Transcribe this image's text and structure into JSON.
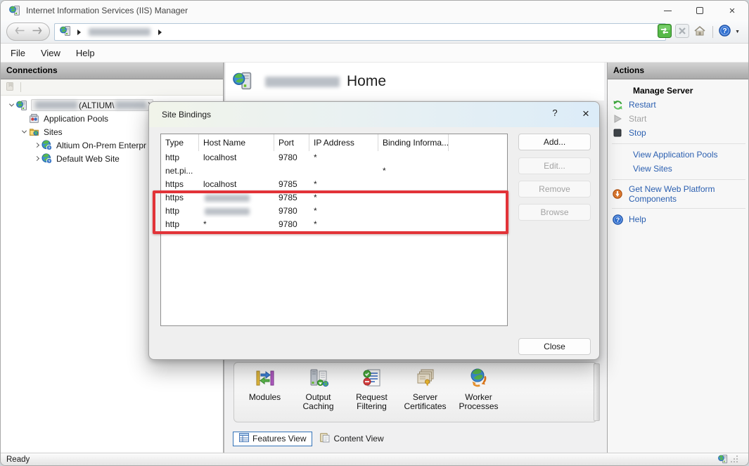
{
  "colors": {
    "link_blue": "#2b5fb0",
    "annotation_red": "#e23338",
    "disabled_gray": "#a3a3a3",
    "go_green": "#56b948",
    "header_gray": "#b5b5b5"
  },
  "titlebar": {
    "title": "Internet Information Services (IIS) Manager",
    "close_glyph": "×"
  },
  "nav": {
    "help_glyph": "?",
    "caret_glyph": "▼",
    "server_redacted": true
  },
  "menu": {
    "items": [
      "File",
      "View",
      "Help"
    ]
  },
  "connections": {
    "header": "Connections",
    "root": {
      "name_redacted": true,
      "open_text": " (ALTIUM\\",
      "account_redacted": true,
      "close_text": ")"
    },
    "items": [
      {
        "label": "Application Pools",
        "icon": "app-pools",
        "level": 1,
        "expand": "none"
      },
      {
        "label": "Sites",
        "icon": "folder-sites",
        "level": 1,
        "expand": "open"
      },
      {
        "label": "Altium On-Prem Enterpr",
        "icon": "site-globe",
        "level": 2,
        "expand": "closed"
      },
      {
        "label": "Default Web Site",
        "icon": "site-globe",
        "level": 2,
        "expand": "closed"
      }
    ]
  },
  "home": {
    "server_redacted": true,
    "title": "Home"
  },
  "features": {
    "items": [
      {
        "label": "Modules",
        "icon": "modules"
      },
      {
        "label": "Output Caching",
        "icon": "output-caching"
      },
      {
        "label": "Request Filtering",
        "icon": "request-filtering"
      },
      {
        "label": "Server Certificates",
        "icon": "server-certificates"
      },
      {
        "label": "Worker Processes",
        "icon": "worker-processes"
      }
    ]
  },
  "view_tabs": [
    {
      "label": "Features View",
      "icon": "tab-grid",
      "selected": true
    },
    {
      "label": "Content View",
      "icon": "tab-content",
      "selected": false
    }
  ],
  "actions": {
    "title": "Actions",
    "groups": [
      {
        "items": [
          {
            "label": "Manage Server",
            "style": "heading"
          },
          {
            "label": "Restart",
            "icon": "restart",
            "style": "link"
          },
          {
            "label": "Start",
            "icon": "start",
            "style": "disabled"
          },
          {
            "label": "Stop",
            "icon": "stop",
            "style": "link"
          }
        ]
      },
      {
        "items": [
          {
            "label": "View Application Pools",
            "style": "link"
          },
          {
            "label": "View Sites",
            "style": "link"
          }
        ]
      },
      {
        "items": [
          {
            "label": "Get New Web Platform Components",
            "icon": "web-platform",
            "style": "link",
            "wrap": true
          }
        ]
      },
      {
        "items": [
          {
            "label": "Help",
            "icon": "help-circle",
            "style": "link"
          }
        ]
      }
    ]
  },
  "dialog": {
    "title": "Site Bindings",
    "help_glyph": "?",
    "close_glyph": "×",
    "columns": [
      "Type",
      "Host Name",
      "Port",
      "IP Address",
      "Binding Informa..."
    ],
    "rows": [
      {
        "type": "http",
        "host": "localhost",
        "port": "9780",
        "ip": "*",
        "binding": "",
        "highlighted": false
      },
      {
        "type": "net.pi...",
        "host": "",
        "port": "",
        "ip": "",
        "binding": "*",
        "highlighted": false
      },
      {
        "type": "https",
        "host": "localhost",
        "port": "9785",
        "ip": "*",
        "binding": "",
        "highlighted": false
      },
      {
        "type": "https",
        "host_redacted": true,
        "port": "9785",
        "ip": "*",
        "binding": "",
        "highlighted": true
      },
      {
        "type": "http",
        "host_redacted": true,
        "port": "9780",
        "ip": "*",
        "binding": "",
        "highlighted": true
      },
      {
        "type": "http",
        "host": "*",
        "port": "9780",
        "ip": "*",
        "binding": "",
        "highlighted": true
      }
    ],
    "buttons": [
      {
        "label": "Add...",
        "enabled": true
      },
      {
        "label": "Edit...",
        "enabled": false
      },
      {
        "label": "Remove",
        "enabled": false
      },
      {
        "label": "Browse",
        "enabled": false
      }
    ],
    "close_label": "Close"
  },
  "statusbar": {
    "text": "Ready"
  }
}
